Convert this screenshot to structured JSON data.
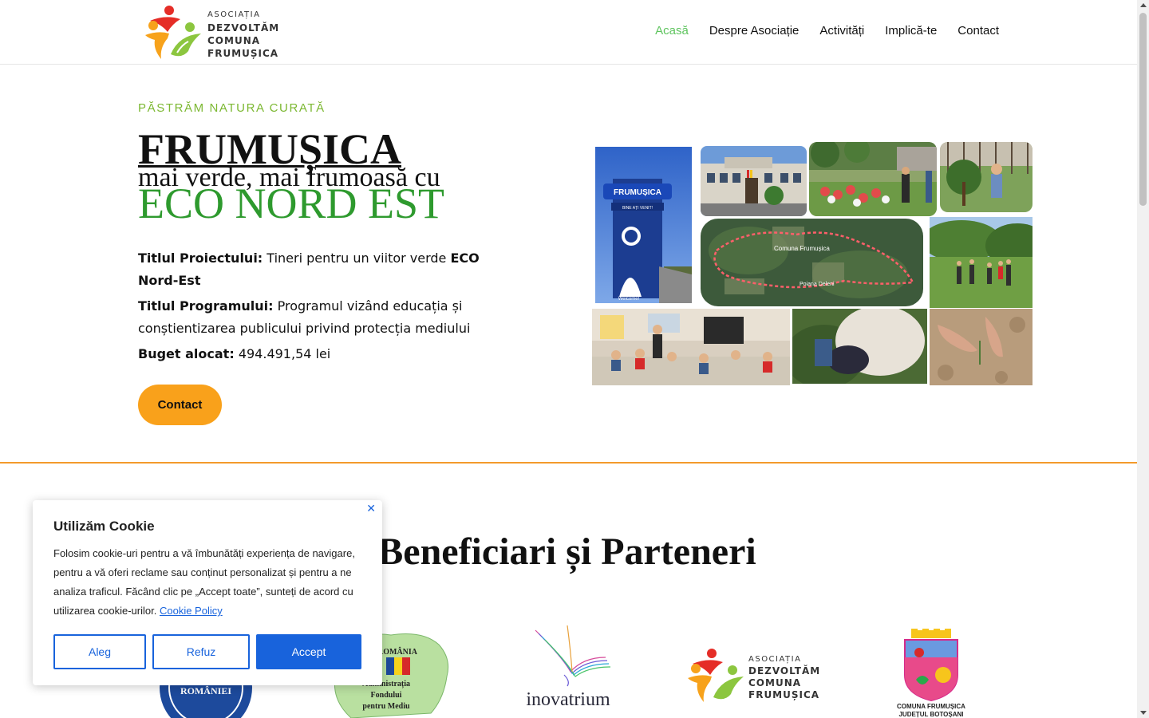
{
  "header": {
    "logo": {
      "line1": "ASOCIAȚIA",
      "line2": "DEZVOLTĂM",
      "line3": "COMUNA",
      "line4": "FRUMUȘICA"
    },
    "nav": [
      {
        "label": "Acasă",
        "active": true
      },
      {
        "label": "Despre Asociație",
        "active": false
      },
      {
        "label": "Activități",
        "active": false
      },
      {
        "label": "Implică-te",
        "active": false
      },
      {
        "label": "Contact",
        "active": false
      }
    ]
  },
  "hero": {
    "eyebrow": "PĂSTRĂM NATURA CURATĂ",
    "title": "FRUMUȘICA",
    "subtitle": "mai verde, mai frumoasă cu",
    "highlight": "ECO NORD EST",
    "project_label": "Titlul Proiectului:",
    "project_value": "Tineri pentru un viitor verde",
    "project_value_bold": "ECO Nord-Est",
    "program_label": "Titlul Programului:",
    "program_value": "Programul vizând educația și conștientizarea publicului privind protecția mediului",
    "budget_label": "Buget alocat:",
    "budget_value": "494.491,54 lei",
    "contact_button": "Contact"
  },
  "collage": {
    "sign_text": "FRUMUȘICA",
    "sign_sub": "BINE AȚI VENIT!",
    "sign_footer": "Welcome!",
    "map_label1": "Comuna Frumușica",
    "map_label2": "Poiana Deleni"
  },
  "partners": {
    "title": "Beneficiari și Parteneri",
    "afm": {
      "line1": "ROMÂNIA",
      "line2": "Administrația",
      "line3": "Fondului",
      "line4": "pentru Mediu"
    },
    "inovatrium": "inovatrium",
    "asoc": {
      "line1": "ASOCIAȚIA",
      "line2": "DEZVOLTĂM",
      "line3": "COMUNA",
      "line4": "FRUMUȘICA"
    },
    "comuna": {
      "line1": "COMUNA FRUMUȘICA",
      "line2": "JUDEȚUL BOTOȘANI"
    },
    "ro_gov": "ROMÂNIEI"
  },
  "cookie": {
    "title": "Utilizăm Cookie",
    "text": "Folosim cookie-uri pentru a vă îmbunătăți experiența de navigare, pentru a vă oferi reclame sau conținut personalizat și pentru a ne analiza traficul. Făcând clic pe „Accept toate”, sunteți de acord cu utilizarea cookie-urilor.",
    "link": "Cookie Policy",
    "btn_customize": "Aleg",
    "btn_reject": "Refuz",
    "btn_accept": "Accept",
    "close": "✕"
  },
  "colors": {
    "accent_green": "#5ec45e",
    "eyebrow_green": "#7cb832",
    "eco_green": "#2e9a2e",
    "orange": "#f9a11b",
    "divider": "#f39a2b",
    "cookie_blue": "#1863dc"
  }
}
